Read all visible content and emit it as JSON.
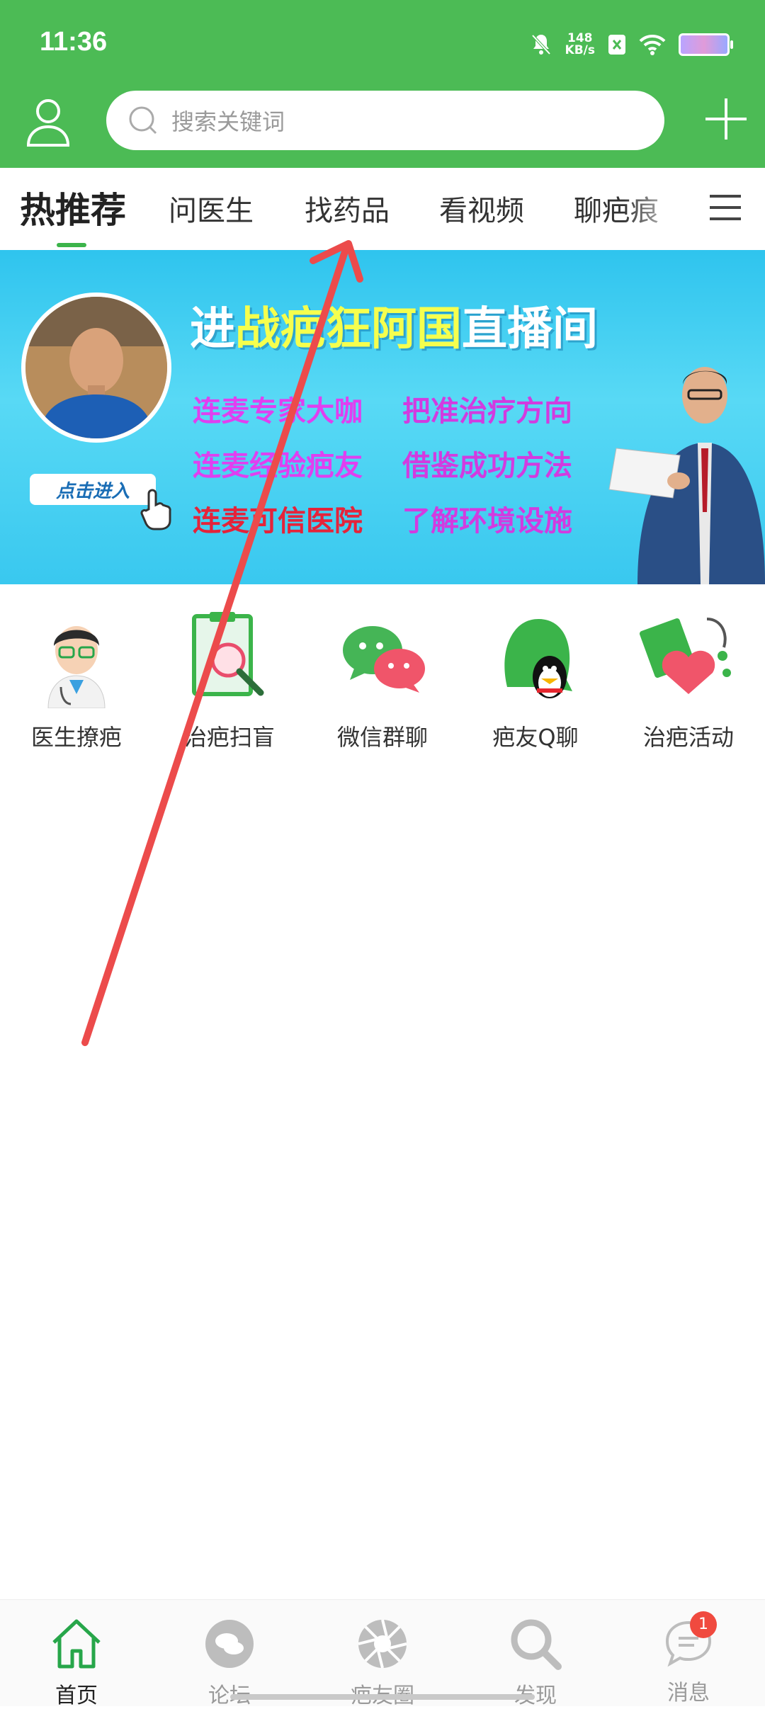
{
  "status_bar": {
    "time": "11:36",
    "net_speed_value": "148",
    "net_speed_unit": "KB/s"
  },
  "header": {
    "search_placeholder": "搜索关键词",
    "accent_color": "#4cbb55"
  },
  "tabs": [
    {
      "label": "热推荐",
      "active": true
    },
    {
      "label": "问医生",
      "active": false
    },
    {
      "label": "找药品",
      "active": false
    },
    {
      "label": "看视频",
      "active": false
    },
    {
      "label": "聊疤痕",
      "active": false
    }
  ],
  "banner": {
    "title_prefix": "进",
    "title_highlight": "战疤狂阿国",
    "title_suffix": "直播间",
    "lines": [
      {
        "left": "连麦专家大咖",
        "right": "把准治疗方向"
      },
      {
        "left": "连麦经验疤友",
        "right": "借鉴成功方法"
      },
      {
        "left": "连麦可信医院",
        "right": "了解环境设施"
      }
    ],
    "enter_button": "点击进入"
  },
  "quick_icons": [
    {
      "label": "医生撩疤",
      "icon": "doctor-icon"
    },
    {
      "label": "治疤扫盲",
      "icon": "document-magnifier-icon"
    },
    {
      "label": "微信群聊",
      "icon": "wechat-icon"
    },
    {
      "label": "疤友Q聊",
      "icon": "qq-icon"
    },
    {
      "label": "治疤活动",
      "icon": "stethoscope-heart-icon"
    }
  ],
  "bottom_nav": [
    {
      "label": "首页",
      "icon": "home-icon",
      "active": true
    },
    {
      "label": "论坛",
      "icon": "chat-bubble-icon",
      "active": false
    },
    {
      "label": "疤友圈",
      "icon": "aperture-icon",
      "active": false
    },
    {
      "label": "发现",
      "icon": "search-icon",
      "active": false
    },
    {
      "label": "消息",
      "icon": "message-icon",
      "active": false,
      "badge": "1"
    }
  ]
}
